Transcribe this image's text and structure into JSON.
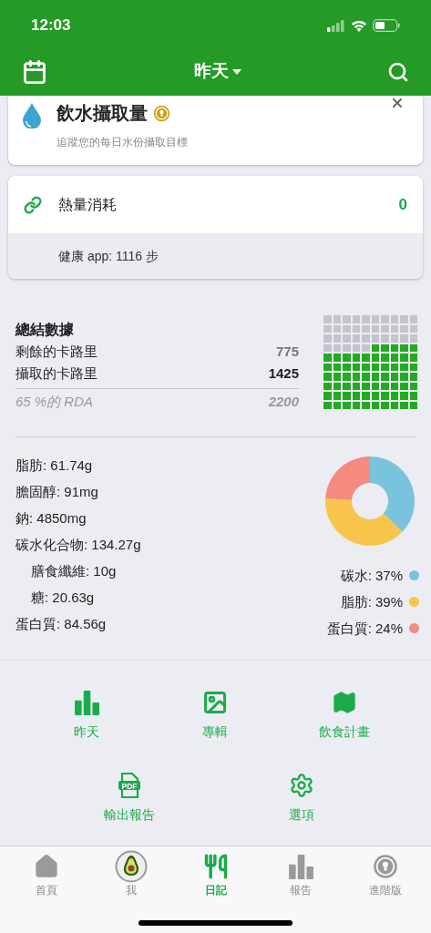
{
  "status_bar": {
    "time": "12:03"
  },
  "header": {
    "title": "昨天"
  },
  "water_card": {
    "title": "飲水攝取量",
    "subtitle": "追蹤您的每日水份攝取目標"
  },
  "burn_card": {
    "title": "熱量消耗",
    "value": "0",
    "health_app": "健康 app: 1116 步"
  },
  "summary": {
    "title": "總結數據",
    "rows": [
      {
        "kind": "remaining",
        "label": "剩餘的卡路里",
        "value": "775"
      },
      {
        "kind": "consumed",
        "label": "攝取的卡路里",
        "value": "1425"
      },
      {
        "kind": "rda",
        "label": "65 %的 RDA",
        "value": "2200"
      }
    ]
  },
  "nutrients": [
    {
      "text": "脂肪: 61.74g"
    },
    {
      "text": "膽固醇: 91mg"
    },
    {
      "text": "鈉: 4850mg"
    },
    {
      "text": "碳水化合物: 134.27g",
      "children": [
        {
          "text": "膳食纖維: 10g"
        },
        {
          "text": "糖: 20.63g"
        }
      ]
    },
    {
      "text": "蛋白質: 84.56g"
    }
  ],
  "macros": {
    "chart_data": {
      "type": "donut",
      "categories": [
        "碳水: 37%",
        "脂肪: 39%",
        "蛋白質: 24%"
      ],
      "values": [
        37,
        39,
        24
      ]
    },
    "legend": [
      {
        "color": "#7ac3dc"
      },
      {
        "color": "#f8c54c"
      },
      {
        "color": "#f48a80"
      }
    ]
  },
  "shortcut_rows": [
    {
      "items": [
        {
          "kind": "bars",
          "label": "昨天"
        },
        {
          "kind": "image",
          "label": "專輯"
        },
        {
          "kind": "map",
          "label": "飲食計畫"
        }
      ]
    },
    {
      "items": [
        {
          "kind": "pdf",
          "icon_text": "PDF",
          "label": "輸出報告"
        },
        {
          "kind": "gear",
          "label": "選項"
        }
      ]
    }
  ],
  "tab_bar": [
    {
      "kind": "home",
      "label": "首頁",
      "selected": false
    },
    {
      "kind": "avatar",
      "label": "我",
      "selected": false
    },
    {
      "kind": "utensils",
      "label": "日記",
      "selected": true
    },
    {
      "kind": "bars",
      "label": "報告",
      "selected": false
    },
    {
      "kind": "badge",
      "label": "進階版",
      "selected": false
    }
  ]
}
